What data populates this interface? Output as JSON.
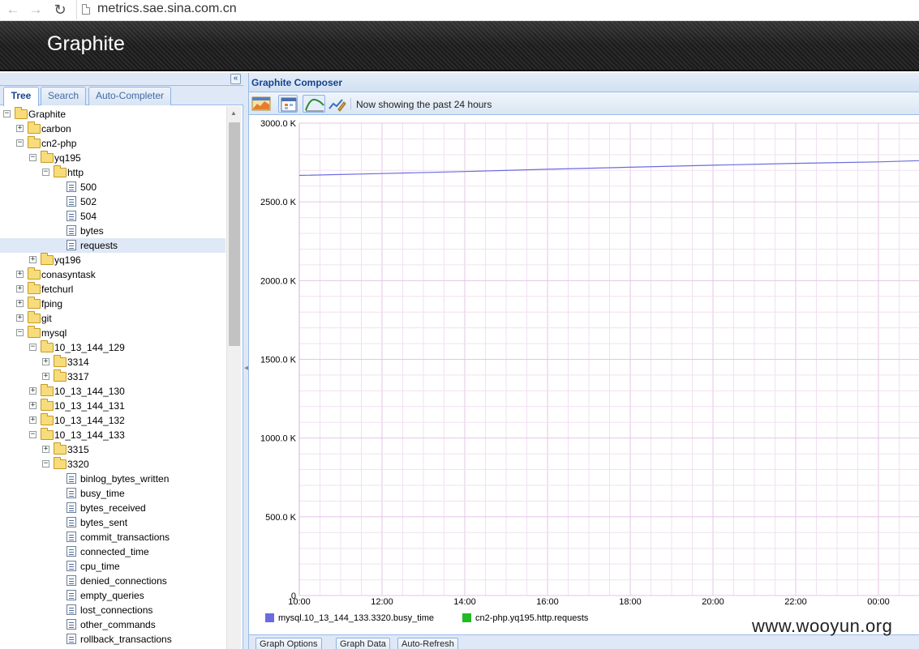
{
  "browser": {
    "url": "metrics.sae.sina.com.cn"
  },
  "header": {
    "title": "Graphite"
  },
  "left_panel": {
    "collapse_glyph": "«",
    "tabs": [
      {
        "label": "Tree",
        "active": true
      },
      {
        "label": "Search",
        "active": false
      },
      {
        "label": "Auto-Completer",
        "active": false
      }
    ],
    "tree": [
      {
        "label": "Graphite",
        "depth": 0,
        "type": "folder",
        "expanded": true
      },
      {
        "label": "carbon",
        "depth": 1,
        "type": "folder",
        "expanded": false
      },
      {
        "label": "cn2-php",
        "depth": 1,
        "type": "folder",
        "expanded": true
      },
      {
        "label": "yq195",
        "depth": 2,
        "type": "folder",
        "expanded": true
      },
      {
        "label": "http",
        "depth": 3,
        "type": "folder",
        "expanded": true
      },
      {
        "label": "500",
        "depth": 4,
        "type": "leaf"
      },
      {
        "label": "502",
        "depth": 4,
        "type": "leaf"
      },
      {
        "label": "504",
        "depth": 4,
        "type": "leaf"
      },
      {
        "label": "bytes",
        "depth": 4,
        "type": "leaf"
      },
      {
        "label": "requests",
        "depth": 4,
        "type": "leaf",
        "selected": true
      },
      {
        "label": "yq196",
        "depth": 2,
        "type": "folder",
        "expanded": false
      },
      {
        "label": "conasyntask",
        "depth": 1,
        "type": "folder",
        "expanded": false
      },
      {
        "label": "fetchurl",
        "depth": 1,
        "type": "folder",
        "expanded": false
      },
      {
        "label": "fping",
        "depth": 1,
        "type": "folder",
        "expanded": false
      },
      {
        "label": "git",
        "depth": 1,
        "type": "folder",
        "expanded": false
      },
      {
        "label": "mysql",
        "depth": 1,
        "type": "folder",
        "expanded": true
      },
      {
        "label": "10_13_144_129",
        "depth": 2,
        "type": "folder",
        "expanded": true
      },
      {
        "label": "3314",
        "depth": 3,
        "type": "folder",
        "expanded": false
      },
      {
        "label": "3317",
        "depth": 3,
        "type": "folder",
        "expanded": false
      },
      {
        "label": "10_13_144_130",
        "depth": 2,
        "type": "folder",
        "expanded": false
      },
      {
        "label": "10_13_144_131",
        "depth": 2,
        "type": "folder",
        "expanded": false
      },
      {
        "label": "10_13_144_132",
        "depth": 2,
        "type": "folder",
        "expanded": false
      },
      {
        "label": "10_13_144_133",
        "depth": 2,
        "type": "folder",
        "expanded": true
      },
      {
        "label": "3315",
        "depth": 3,
        "type": "folder",
        "expanded": false
      },
      {
        "label": "3320",
        "depth": 3,
        "type": "folder",
        "expanded": true
      },
      {
        "label": "binlog_bytes_written",
        "depth": 4,
        "type": "leaf"
      },
      {
        "label": "busy_time",
        "depth": 4,
        "type": "leaf"
      },
      {
        "label": "bytes_received",
        "depth": 4,
        "type": "leaf"
      },
      {
        "label": "bytes_sent",
        "depth": 4,
        "type": "leaf"
      },
      {
        "label": "commit_transactions",
        "depth": 4,
        "type": "leaf"
      },
      {
        "label": "connected_time",
        "depth": 4,
        "type": "leaf"
      },
      {
        "label": "cpu_time",
        "depth": 4,
        "type": "leaf"
      },
      {
        "label": "denied_connections",
        "depth": 4,
        "type": "leaf"
      },
      {
        "label": "empty_queries",
        "depth": 4,
        "type": "leaf"
      },
      {
        "label": "lost_connections",
        "depth": 4,
        "type": "leaf"
      },
      {
        "label": "other_commands",
        "depth": 4,
        "type": "leaf"
      },
      {
        "label": "rollback_transactions",
        "depth": 4,
        "type": "leaf"
      }
    ]
  },
  "composer": {
    "title": "Graphite Composer",
    "showing_text": "Now showing the past 24 hours",
    "toolbar_icons": [
      "dashboard-icon",
      "calendar-icon",
      "recent-data-icon",
      "edit-graph-icon"
    ],
    "bottom_buttons": [
      "Graph Options",
      "Graph Data",
      "Auto-Refresh"
    ]
  },
  "chart_data": {
    "type": "line",
    "yticks": [
      "3000.0 K",
      "2500.0 K",
      "2000.0 K",
      "1500.0 K",
      "1000.0 K",
      "500.0 K",
      "0"
    ],
    "ylim": [
      0,
      3000
    ],
    "xticks": [
      "10:00",
      "12:00",
      "14:00",
      "16:00",
      "18:00",
      "20:00",
      "22:00",
      "00:00"
    ],
    "grid": true,
    "series": [
      {
        "name": "mysql.10_13_144_133.3320.busy_time",
        "color": "#6b6be0",
        "x": [
          "10:00",
          "12:00",
          "14:00",
          "16:00",
          "18:00",
          "20:00",
          "22:00",
          "00:00",
          "01:00"
        ],
        "values": [
          2668,
          2680,
          2693,
          2707,
          2720,
          2733,
          2745,
          2754,
          2762
        ]
      },
      {
        "name": "cn2-php.yq195.http.requests",
        "color": "#22bb22",
        "x": [],
        "values": []
      }
    ]
  },
  "watermark": "www.wooyun.org"
}
